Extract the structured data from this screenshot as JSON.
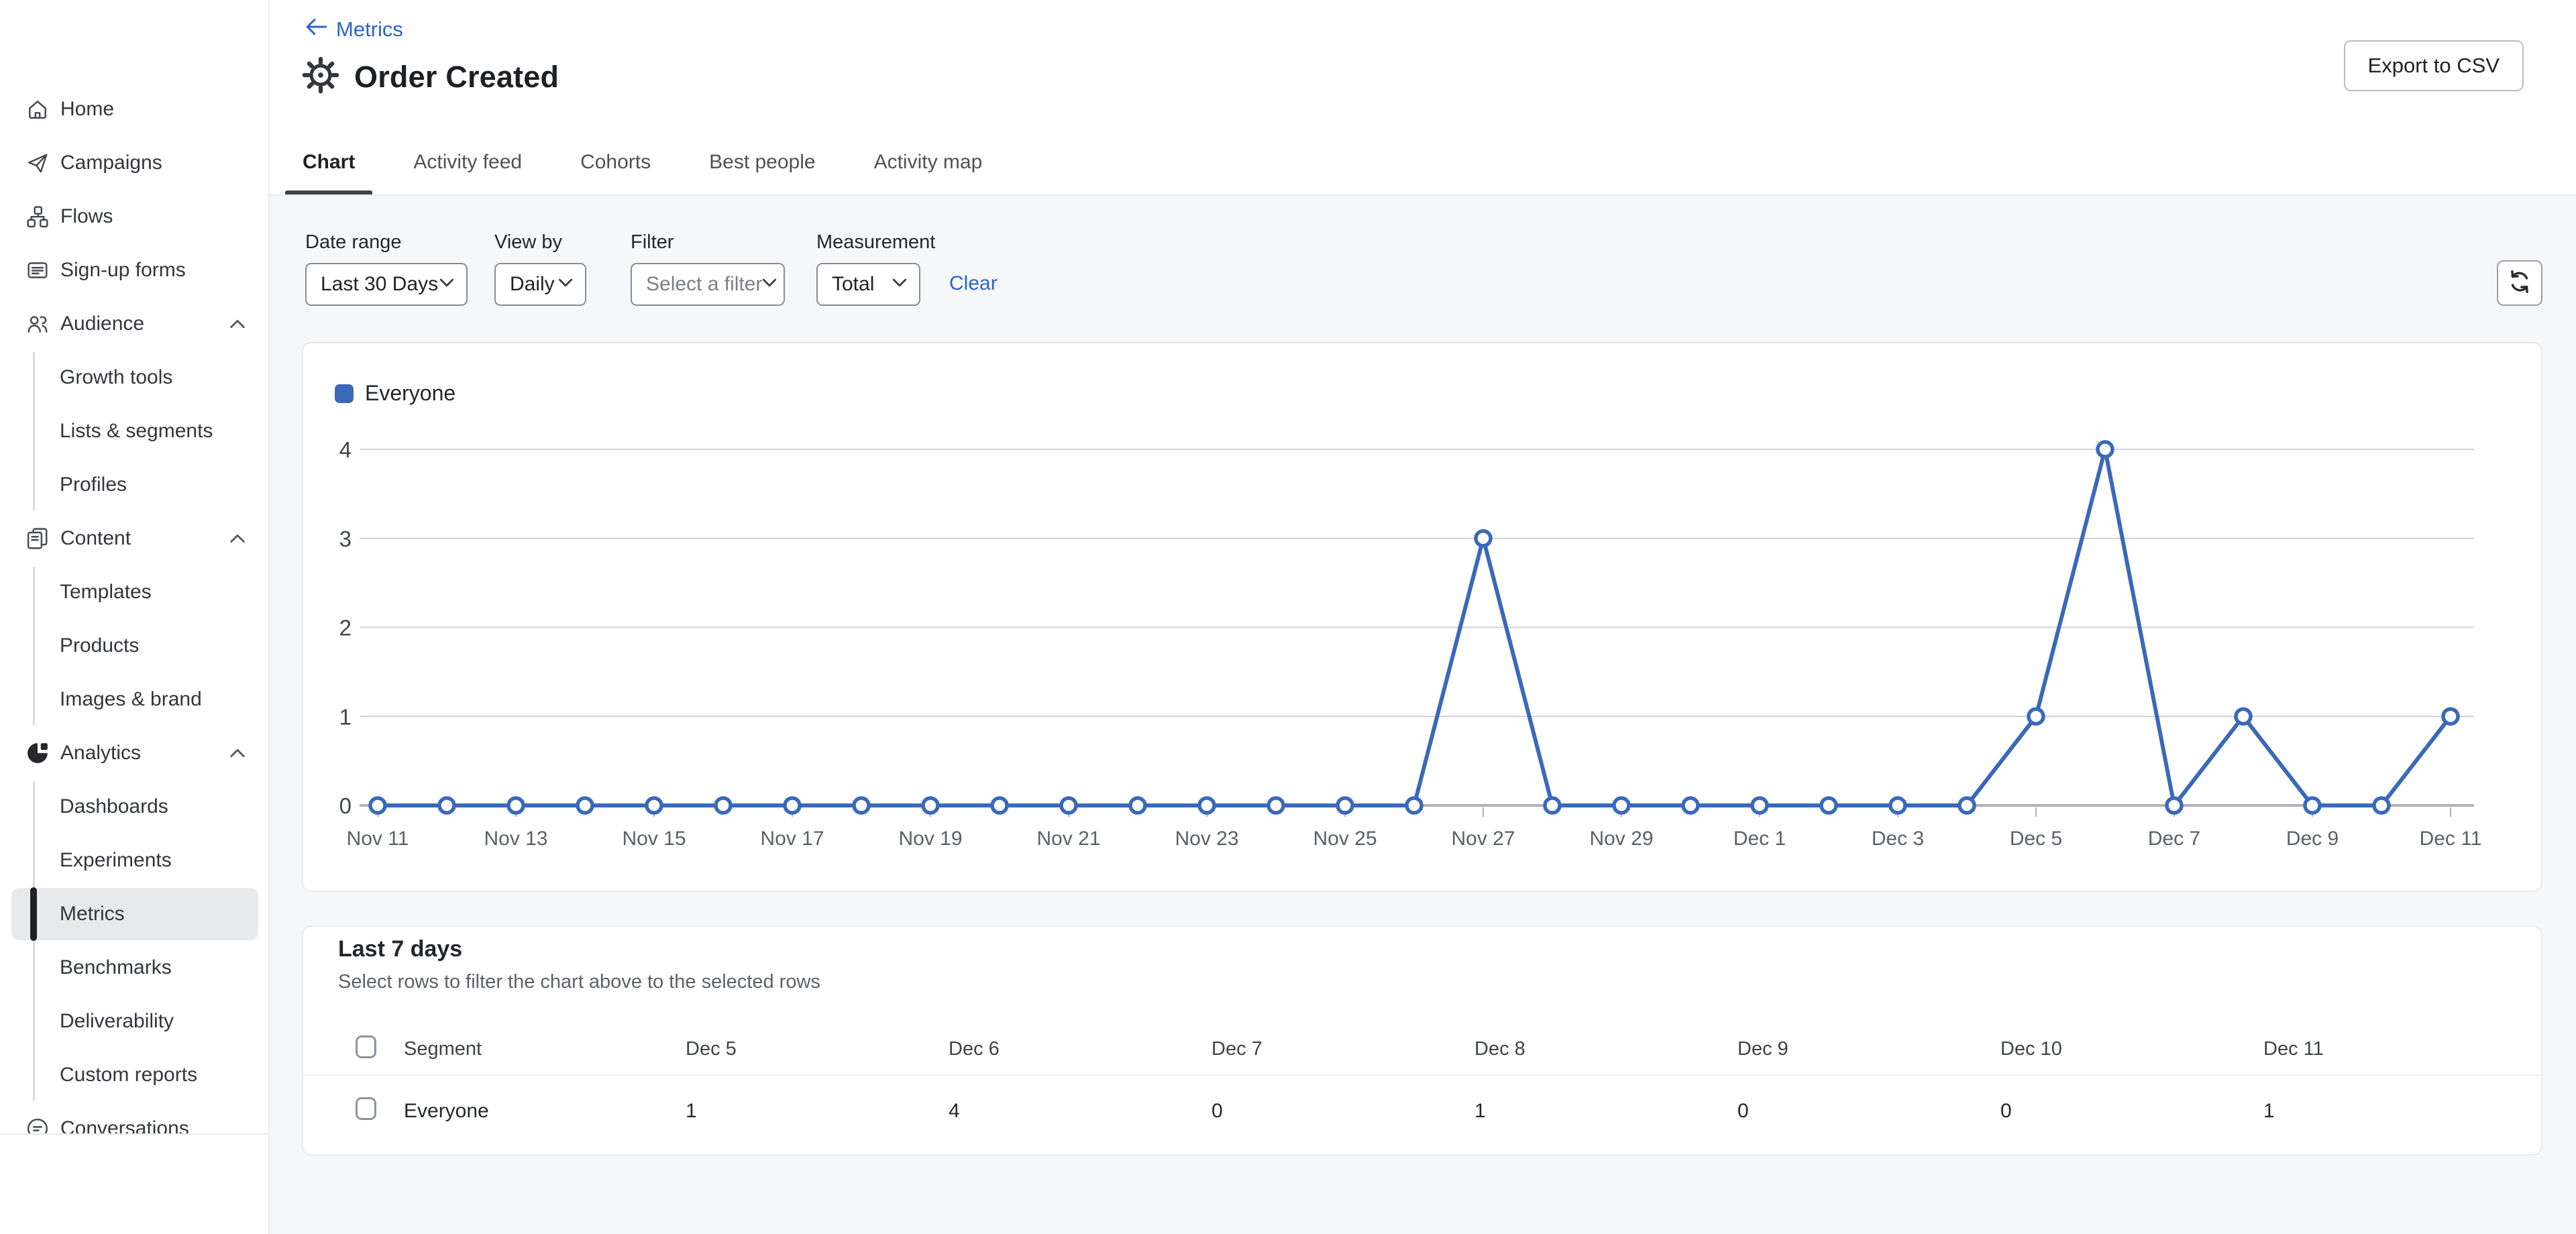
{
  "sidebar": {
    "items": {
      "home": "Home",
      "campaigns": "Campaigns",
      "flows": "Flows",
      "signup_forms": "Sign-up forms",
      "audience": "Audience",
      "growth_tools": "Growth tools",
      "lists_segments": "Lists & segments",
      "profiles": "Profiles",
      "content": "Content",
      "templates": "Templates",
      "products": "Products",
      "images_brand": "Images & brand",
      "analytics": "Analytics",
      "dashboards": "Dashboards",
      "experiments": "Experiments",
      "metrics": "Metrics",
      "benchmarks": "Benchmarks",
      "deliverability": "Deliverability",
      "custom_reports": "Custom reports",
      "conversations": "Conversations"
    },
    "selected_item": "Metrics"
  },
  "header": {
    "back_link": "Metrics",
    "title": "Order Created",
    "export_button": "Export to CSV"
  },
  "tabs": {
    "chart": "Chart",
    "activity_feed": "Activity feed",
    "cohorts": "Cohorts",
    "best_people": "Best people",
    "activity_map": "Activity map",
    "active": "Chart"
  },
  "filters": {
    "date_range_label": "Date range",
    "date_range_value": "Last 30 Days",
    "view_by_label": "View by",
    "view_by_value": "Daily",
    "filter_label": "Filter",
    "filter_placeholder": "Select a filter",
    "measurement_label": "Measurement",
    "measurement_value": "Total",
    "clear_label": "Clear"
  },
  "chart_data": {
    "type": "line",
    "title": "",
    "x": [
      "Nov 11",
      "Nov 12",
      "Nov 13",
      "Nov 14",
      "Nov 15",
      "Nov 16",
      "Nov 17",
      "Nov 18",
      "Nov 19",
      "Nov 20",
      "Nov 21",
      "Nov 22",
      "Nov 23",
      "Nov 24",
      "Nov 25",
      "Nov 26",
      "Nov 27",
      "Nov 28",
      "Nov 29",
      "Nov 30",
      "Dec 1",
      "Dec 2",
      "Dec 3",
      "Dec 4",
      "Dec 5",
      "Dec 6",
      "Dec 7",
      "Dec 8",
      "Dec 9",
      "Dec 10",
      "Dec 11"
    ],
    "x_tick_interval": 2,
    "series": [
      {
        "name": "Everyone",
        "color": "#3a69b9",
        "values": [
          0,
          0,
          0,
          0,
          0,
          0,
          0,
          0,
          0,
          0,
          0,
          0,
          0,
          0,
          0,
          0,
          3,
          0,
          0,
          0,
          0,
          0,
          0,
          0,
          1,
          4,
          0,
          1,
          0,
          0,
          1
        ]
      }
    ],
    "ylim": [
      0,
      4
    ],
    "yticks": [
      4,
      3,
      2,
      1,
      0
    ],
    "grid": true,
    "legend_position": "top-left",
    "marker": "open-circle"
  },
  "table": {
    "title": "Last 7 days",
    "subtitle": "Select rows to filter the chart above to the selected rows",
    "columns": [
      "Segment",
      "Dec 5",
      "Dec 6",
      "Dec 7",
      "Dec 8",
      "Dec 9",
      "Dec 10",
      "Dec 11"
    ],
    "rows": [
      {
        "segment": "Everyone",
        "values": [
          "1",
          "4",
          "0",
          "1",
          "0",
          "0",
          "1"
        ]
      }
    ]
  },
  "colors": {
    "link_blue": "#2c63c6",
    "chart_blue": "#3a69b9",
    "background_gray": "#f6f7f8"
  }
}
